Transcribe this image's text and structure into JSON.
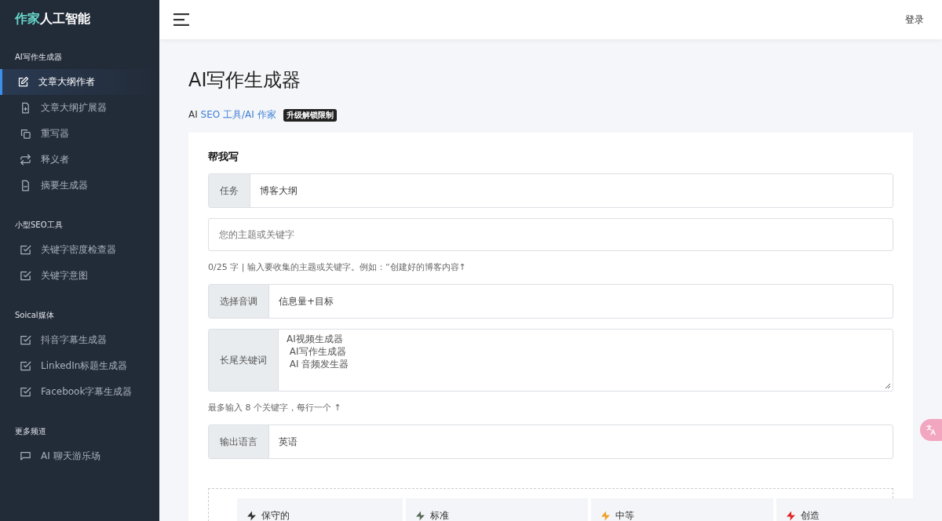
{
  "sidebar": {
    "logo": {
      "accent": "作家",
      "rest": "人工智能"
    },
    "groups": [
      {
        "title": "AI写作生成器",
        "items": [
          {
            "label": "文章大纲作者",
            "kind": "edit",
            "selected": true
          },
          {
            "label": "文章大纲扩展器",
            "kind": "file-plus",
            "selected": false
          },
          {
            "label": "重写器",
            "kind": "copy",
            "selected": false
          },
          {
            "label": "释义者",
            "kind": "repeat",
            "selected": false
          },
          {
            "label": "摘要生成器",
            "kind": "file-minus",
            "selected": false
          }
        ]
      },
      {
        "title": "小型SEO工具",
        "items": [
          {
            "label": "关键字密度检查器",
            "kind": "check",
            "selected": false
          },
          {
            "label": "关键字意图",
            "kind": "check",
            "selected": false
          }
        ]
      },
      {
        "title": "Soical媒体",
        "items": [
          {
            "label": "抖音字幕生成器",
            "kind": "check",
            "selected": false
          },
          {
            "label": "LinkedIn标题生成器",
            "kind": "check",
            "selected": false
          },
          {
            "label": "Facebook字幕生成器",
            "kind": "check",
            "selected": false
          }
        ]
      },
      {
        "title": "更多频道",
        "items": [
          {
            "label": "AI 聊天游乐场",
            "kind": "chat",
            "selected": false
          }
        ]
      }
    ]
  },
  "header": {
    "login": "登录"
  },
  "page": {
    "title": "AI写作生成器",
    "breadcrumb": {
      "prefix": "AI ",
      "link": "SEO 工具/AI 作家"
    },
    "badge": "升级解锁限制"
  },
  "form": {
    "heading": "帮我写",
    "task": {
      "label": "任务",
      "value": "博客大纲"
    },
    "topic": {
      "placeholder": "您的主题或关键字"
    },
    "topic_hint": "0/25 字 | 输入要收集的主题或关键字。例如：“创建好的博客内容↑",
    "tone": {
      "label": "选择音调",
      "value": "信息量+目标"
    },
    "keywords": {
      "label": "长尾关键词",
      "value": "AI视频生成器\n AI写作生成器\n AI 音频发生器"
    },
    "keywords_hint": "最多输入 8 个关键字，每行一个 ↑",
    "language": {
      "label": "输出语言",
      "value": "英语"
    },
    "creativity": [
      {
        "title": "保守的",
        "color": "#333333"
      },
      {
        "title": "标准",
        "color": "#5a6b5a"
      },
      {
        "title": "中等",
        "color": "#f0a020"
      },
      {
        "title": "创造",
        "color": "#e02424"
      }
    ]
  }
}
